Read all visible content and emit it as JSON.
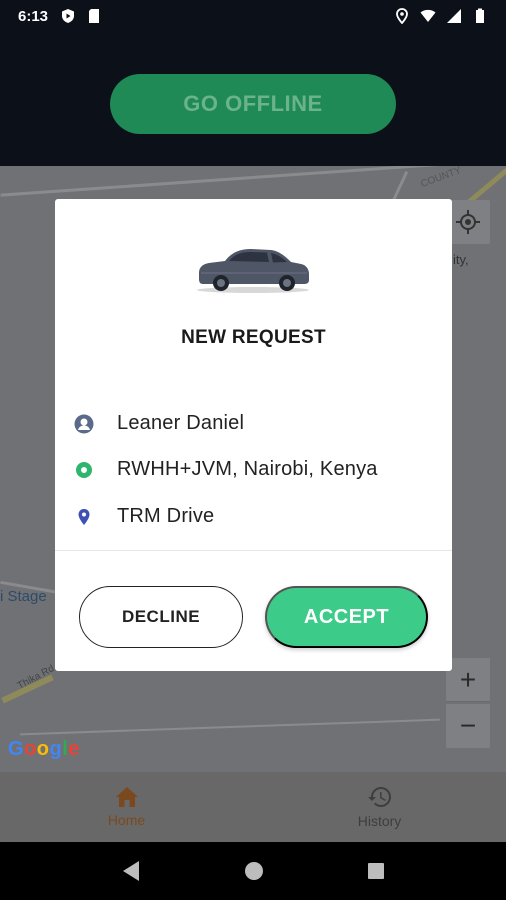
{
  "status_bar": {
    "time": "6:13",
    "left_icons": [
      "shield-play-icon",
      "sd-card-icon"
    ],
    "right_icons": [
      "location-icon",
      "wifi-icon",
      "signal-icon",
      "battery-icon"
    ]
  },
  "header": {
    "go_offline_label": "GO OFFLINE"
  },
  "map": {
    "labels": {
      "stage": "i Stage",
      "thika_rd": "Thika Rd",
      "county": "COUNTY",
      "city": "ity,"
    },
    "zoom_in_label": "+",
    "zoom_out_label": "−",
    "google_letters": [
      "G",
      "o",
      "o",
      "g",
      "l",
      "e"
    ],
    "google_colors": [
      "#4285F4",
      "#EA4335",
      "#FBBC05",
      "#4285F4",
      "#34A853",
      "#EA4335"
    ]
  },
  "modal": {
    "title": "NEW REQUEST",
    "passenger_name": "Leaner Daniel",
    "pickup": "RWHH+JVM, Nairobi, Kenya",
    "destination": "TRM Drive",
    "decline_label": "DECLINE",
    "accept_label": "ACCEPT",
    "accent_color": "#3dcb8a"
  },
  "bottom_nav": {
    "items": [
      {
        "label": "Home",
        "icon": "home-icon",
        "active": true
      },
      {
        "label": "History",
        "icon": "history-icon",
        "active": false
      }
    ]
  },
  "android_nav": {
    "buttons": [
      "back-icon",
      "home-circle-icon",
      "recents-icon"
    ]
  }
}
